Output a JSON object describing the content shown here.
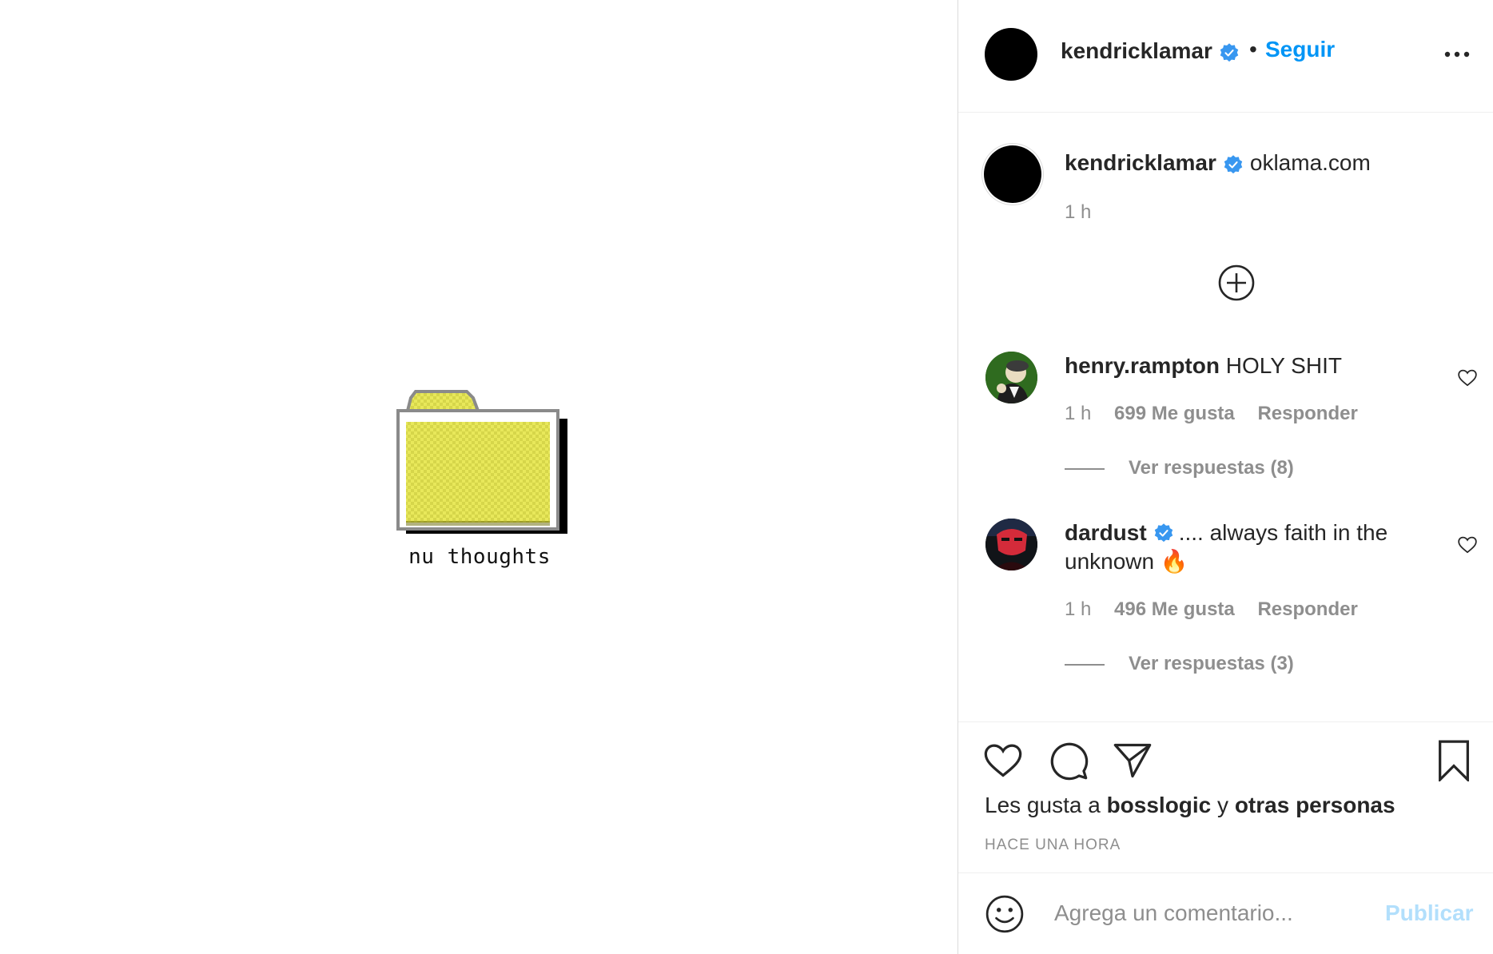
{
  "media": {
    "folder_caption": "nu thoughts"
  },
  "header": {
    "username": "kendricklamar",
    "separator": "•",
    "follow_label": "Seguir"
  },
  "caption": {
    "username": "kendricklamar",
    "text": "oklama.com",
    "time": "1 h"
  },
  "comments": [
    {
      "username": "henry.rampton",
      "verified": false,
      "text": "HOLY SHIT",
      "time": "1 h",
      "likes": "699 Me gusta",
      "reply_label": "Responder",
      "view_replies": "Ver respuestas (8)"
    },
    {
      "username": "dardust",
      "verified": true,
      "text": ".... always faith in the unknown 🔥",
      "time": "1 h",
      "likes": "496 Me gusta",
      "reply_label": "Responder",
      "view_replies": "Ver respuestas (3)"
    }
  ],
  "actions": {
    "liked_prefix": "Les gusta a",
    "liked_user": "bosslogic",
    "liked_joiner": "y",
    "liked_others": "otras personas",
    "timestamp": "HACE UNA HORA"
  },
  "add_comment": {
    "placeholder": "Agrega un comentario...",
    "publish_label": "Publicar"
  },
  "colors": {
    "link_blue": "#0095f6",
    "verified_blue": "#3897f0",
    "secondary_text": "#8e8e8e",
    "publish_disabled": "#b2dffc",
    "folder_yellow": "#e6e65c"
  },
  "icons": {
    "verified": "verified-badge-icon",
    "more": "more-options-icon",
    "load_more": "plus-circle-icon",
    "comment_like": "heart-outline-icon",
    "like": "heart-outline-icon",
    "comment": "comment-bubble-icon",
    "share": "paper-plane-icon",
    "save": "bookmark-icon",
    "emoji": "smiley-face-icon",
    "folder": "yellow-folder-icon"
  }
}
